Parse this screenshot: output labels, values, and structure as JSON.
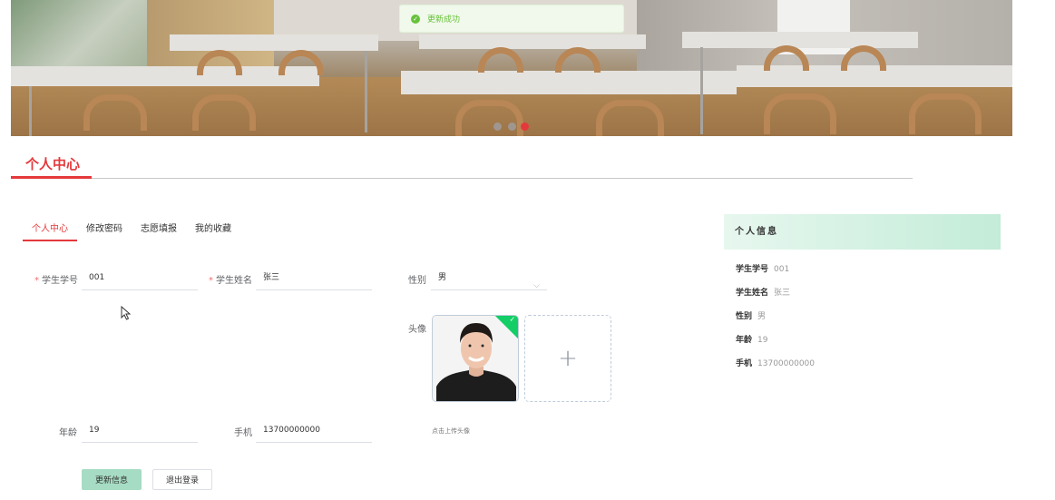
{
  "toast": {
    "message": "更新成功"
  },
  "section": {
    "title": "个人中心"
  },
  "tabs": [
    {
      "label": "个人中心"
    },
    {
      "label": "修改密码"
    },
    {
      "label": "志愿填报"
    },
    {
      "label": "我的收藏"
    }
  ],
  "form": {
    "student_no_label": "学生学号",
    "student_no_value": "001",
    "student_name_label": "学生姓名",
    "student_name_value": "张三",
    "gender_label": "性别",
    "gender_value": "男",
    "avatar_label": "头像",
    "avatar_tip": "点击上传头像",
    "age_label": "年龄",
    "age_value": "19",
    "phone_label": "手机",
    "phone_value": "13700000000",
    "update_button": "更新信息",
    "logout_button": "退出登录"
  },
  "info_panel": {
    "title": "个人信息",
    "rows": [
      {
        "key": "学生学号",
        "value": "001"
      },
      {
        "key": "学生姓名",
        "value": "张三"
      },
      {
        "key": "性别",
        "value": "男"
      },
      {
        "key": "年龄",
        "value": "19"
      },
      {
        "key": "手机",
        "value": "13700000000"
      }
    ]
  },
  "colors": {
    "accent": "#e4393c",
    "success": "#67c23a",
    "primary_button": "#a6dcc3"
  }
}
